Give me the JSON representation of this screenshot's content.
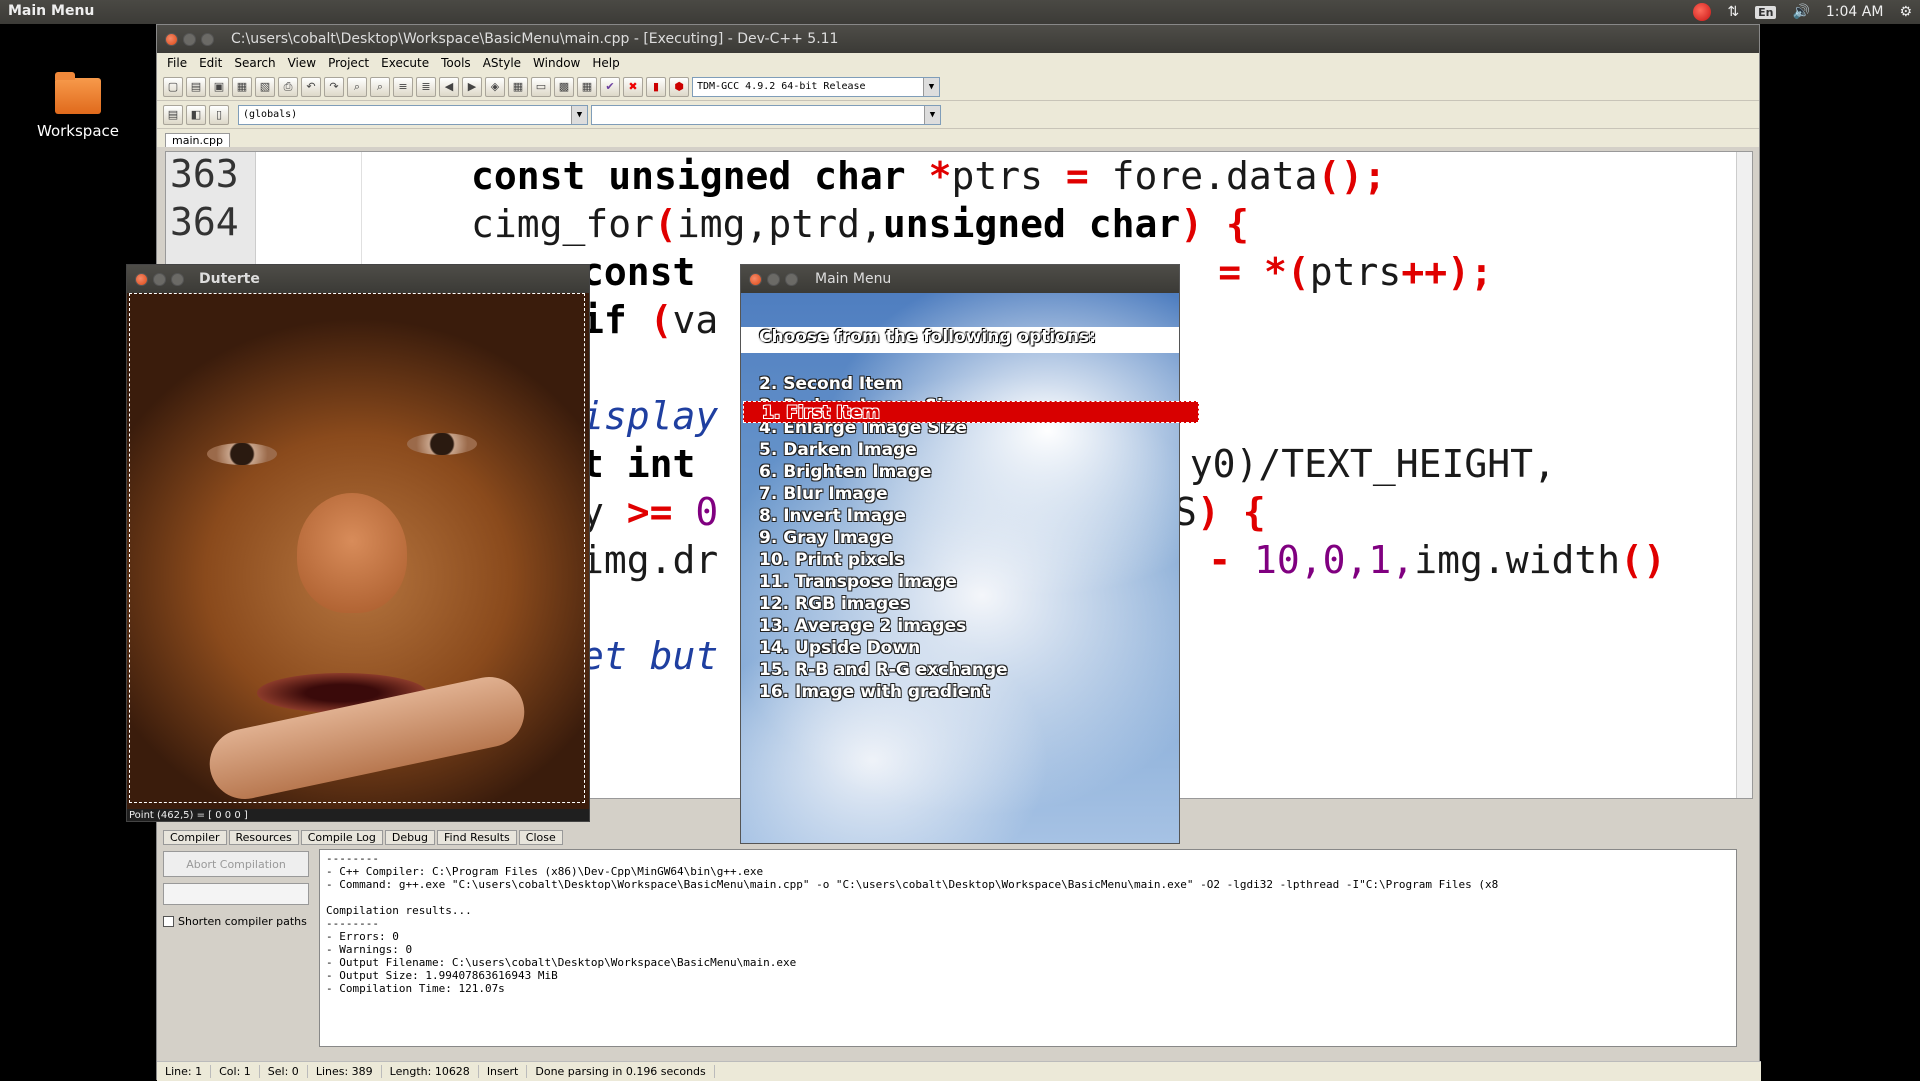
{
  "topbar": {
    "title": "Main Menu",
    "lang": "En",
    "time": "1:04 AM"
  },
  "desktop": {
    "workspace_label": "Workspace"
  },
  "devcpp": {
    "title": "C:\\users\\cobalt\\Desktop\\Workspace\\BasicMenu\\main.cpp - [Executing] - Dev-C++ 5.11",
    "menus": [
      "File",
      "Edit",
      "Search",
      "View",
      "Project",
      "Execute",
      "Tools",
      "AStyle",
      "Window",
      "Help"
    ],
    "compiler": "TDM-GCC 4.9.2 64-bit Release",
    "scope": "(globals)",
    "tab": "main.cpp",
    "line_numbers": [
      "363",
      "364"
    ],
    "code_lines": {
      "l363": {
        "kw": "const unsigned char ",
        "op": "*",
        "id": "ptrs ",
        "eq": "= ",
        "rest": "fore.data",
        "paren": "();"
      },
      "l364": {
        "id": "cimg_for",
        "p1": "(",
        "args": "img,ptrd,",
        "kw": "unsigned char",
        "p2": ") {"
      },
      "l365": {
        "kw": "const ",
        "eq": "= *(",
        "id": "ptrs",
        "pp": "++);"
      },
      "l366": {
        "kw": "if ",
        "p": "(",
        "id": "va"
      },
      "l367": {
        "cm": "isplay"
      },
      "l368": {
        "kw": "t int",
        "paren": "() - ",
        "id": "y0",
        "rest": ")/TEXT_HEIGHT,"
      },
      "l369": {
        "id": "y ",
        "op": ">= ",
        "num": "0",
        "rest": "EMS",
        "p": ") {"
      },
      "l370": {
        "id": "img.dr",
        "op": "- ",
        "num": "10,0,1,",
        "rest": "img.width",
        "p": "()"
      },
      "l371": {
        "cm": "et but"
      }
    },
    "bottom_tabs": [
      "Compiler",
      "Resources",
      "Compile Log",
      "Debug",
      "Find Results",
      "Close"
    ],
    "abort": "Abort Compilation",
    "shorten": "Shorten compiler paths",
    "log": "--------\n- C++ Compiler: C:\\Program Files (x86)\\Dev-Cpp\\MinGW64\\bin\\g++.exe\n- Command: g++.exe \"C:\\users\\cobalt\\Desktop\\Workspace\\BasicMenu\\main.cpp\" -o \"C:\\users\\cobalt\\Desktop\\Workspace\\BasicMenu\\main.exe\" -O2 -lgdi32 -lpthread -I\"C:\\Program Files (x8\n\nCompilation results...\n--------\n- Errors: 0\n- Warnings: 0\n- Output Filename: C:\\users\\cobalt\\Desktop\\Workspace\\BasicMenu\\main.exe\n- Output Size: 1.99407863616943 MiB\n- Compilation Time: 121.07s",
    "status": {
      "line": "Line: 1",
      "col": "Col: 1",
      "sel": "Sel: 0",
      "lines": "Lines: 389",
      "length": "Length: 10628",
      "mode": "Insert",
      "parse": "Done parsing in 0.196 seconds"
    }
  },
  "duterte": {
    "title": "Duterte",
    "point": "Point (462,5) = [ 0 0 0 ]"
  },
  "mainmenu": {
    "title": "Main Menu",
    "prompt": "Choose from the following options:",
    "options": [
      "1. First Item",
      "2. Second Item",
      "3. Reduce Image Size",
      "4. Enlarge Image Size",
      "5. Darken Image",
      "6. Brighten Image",
      "7. Blur Image",
      "8. Invert Image",
      "9. Gray Image",
      "10. Print pixels",
      "11. Transpose image",
      "12. RGB images",
      "13. Average 2 images",
      "14. Upside Down",
      "15. R-B and R-G exchange",
      "16. Image with gradient"
    ]
  }
}
